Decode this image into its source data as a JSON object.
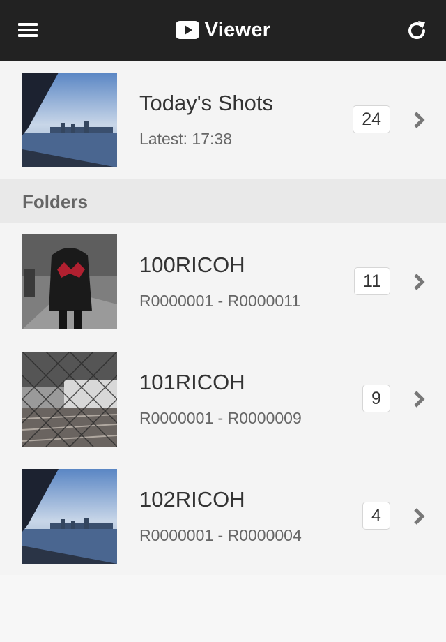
{
  "app": {
    "title": "Viewer",
    "header_bg": "#222222"
  },
  "icons": {
    "menu": "hamburger-menu-icon",
    "logo": "play-button-icon",
    "refresh": "refresh-icon",
    "chevron": "chevron-right-icon"
  },
  "today": {
    "title": "Today's Shots",
    "subtitle": "Latest: 17:38",
    "count": "24"
  },
  "section": {
    "label": "Folders"
  },
  "folders": [
    {
      "name": "100RICOH",
      "range": "R0000001 - R0000011",
      "count": "11"
    },
    {
      "name": "101RICOH",
      "range": "R0000001 - R0000009",
      "count": "9"
    },
    {
      "name": "102RICOH",
      "range": "R0000001 - R0000004",
      "count": "4"
    }
  ]
}
